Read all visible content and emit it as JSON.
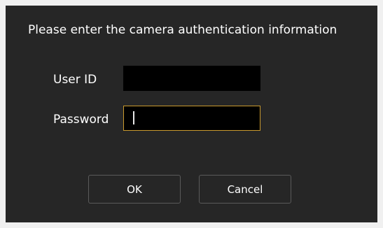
{
  "dialog": {
    "title": "Please enter the camera authentication information",
    "fields": {
      "user_id": {
        "label": "User ID",
        "value": ""
      },
      "password": {
        "label": "Password",
        "value": ""
      }
    },
    "buttons": {
      "ok_label": "OK",
      "cancel_label": "Cancel"
    }
  },
  "colors": {
    "dialog_background": "#262626",
    "input_background": "#000000",
    "focus_border": "#c99a2e",
    "button_border": "#5a5a5a",
    "text": "#ffffff"
  }
}
